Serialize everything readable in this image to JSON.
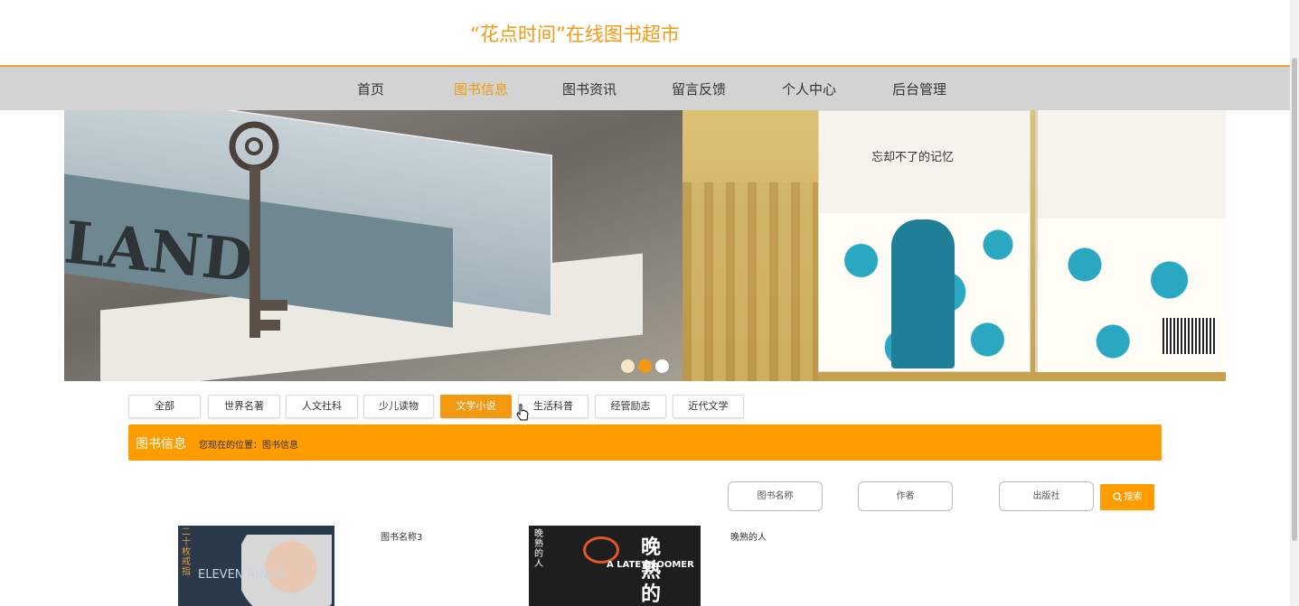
{
  "site": {
    "title": "“花点时间”在线图书超市"
  },
  "nav": {
    "items": [
      "首页",
      "图书信息",
      "图书资讯",
      "留言反馈",
      "个人中心",
      "后台管理"
    ],
    "active_index": 1
  },
  "banner": {
    "left_slide_text": "LAND",
    "right_slide_title": "忘却不了的记忆",
    "dots": 3,
    "active_dot": 1
  },
  "categories": {
    "items": [
      "全部",
      "世界名著",
      "人文社科",
      "少儿读物",
      "文学小说",
      "生活科普",
      "经管励志",
      "近代文学"
    ],
    "active_index": 4
  },
  "section_bar": {
    "title": "图书信息",
    "location": "您现在的位置：图书信息"
  },
  "search": {
    "name_placeholder": "图书名称",
    "author_placeholder": "作者",
    "publisher_placeholder": "出版社",
    "button_label": "搜索"
  },
  "books": [
    {
      "name": "图书名称3",
      "cover_title": "ELEVEN RINGS",
      "cover_side": "二十枚戒指"
    },
    {
      "name": "晚熟的人",
      "cover_title": "晚熟的",
      "cover_en": "A LATE BLOOMER",
      "cover_side": "晚熟的人"
    }
  ],
  "colors": {
    "accent": "#ff9c00",
    "nav_bg": "#d3d3d3",
    "title": "#f39a12"
  }
}
